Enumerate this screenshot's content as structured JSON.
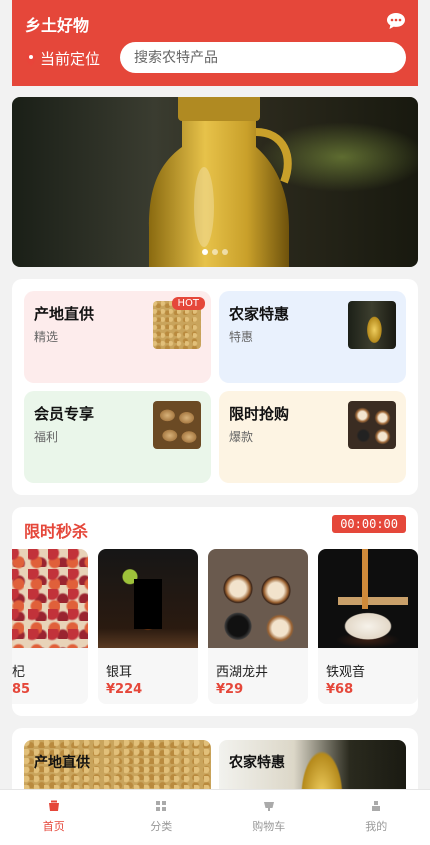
{
  "header": {
    "app_title": "乡土好物",
    "location_label": "当前定位",
    "search_placeholder": "搜索农特产品"
  },
  "banner": {
    "slides": 3,
    "active_slide": 0
  },
  "categories": [
    {
      "title": "产地直供",
      "subtitle": "精选",
      "badge": "HOT"
    },
    {
      "title": "农家特惠",
      "subtitle": "特惠"
    },
    {
      "title": "会员专享",
      "subtitle": "福利"
    },
    {
      "title": "限时抢购",
      "subtitle": "爆款"
    }
  ],
  "flash_sale": {
    "title": "限时秒杀",
    "timer": "00:00:00",
    "products": [
      {
        "name": "杞",
        "price": "85"
      },
      {
        "name": "银耳",
        "price": "¥224"
      },
      {
        "name": "西湖龙井",
        "price": "¥29"
      },
      {
        "name": "铁观音",
        "price": "¥68"
      }
    ]
  },
  "recommend": [
    {
      "title": "产地直供"
    },
    {
      "title": "农家特惠"
    }
  ],
  "tabbar": [
    {
      "label": "首页",
      "icon": "home-icon",
      "active": true
    },
    {
      "label": "分类",
      "icon": "grid-icon"
    },
    {
      "label": "购物车",
      "icon": "cart-icon"
    },
    {
      "label": "我的",
      "icon": "user-icon"
    }
  ],
  "colors": {
    "accent": "#e5473a"
  }
}
